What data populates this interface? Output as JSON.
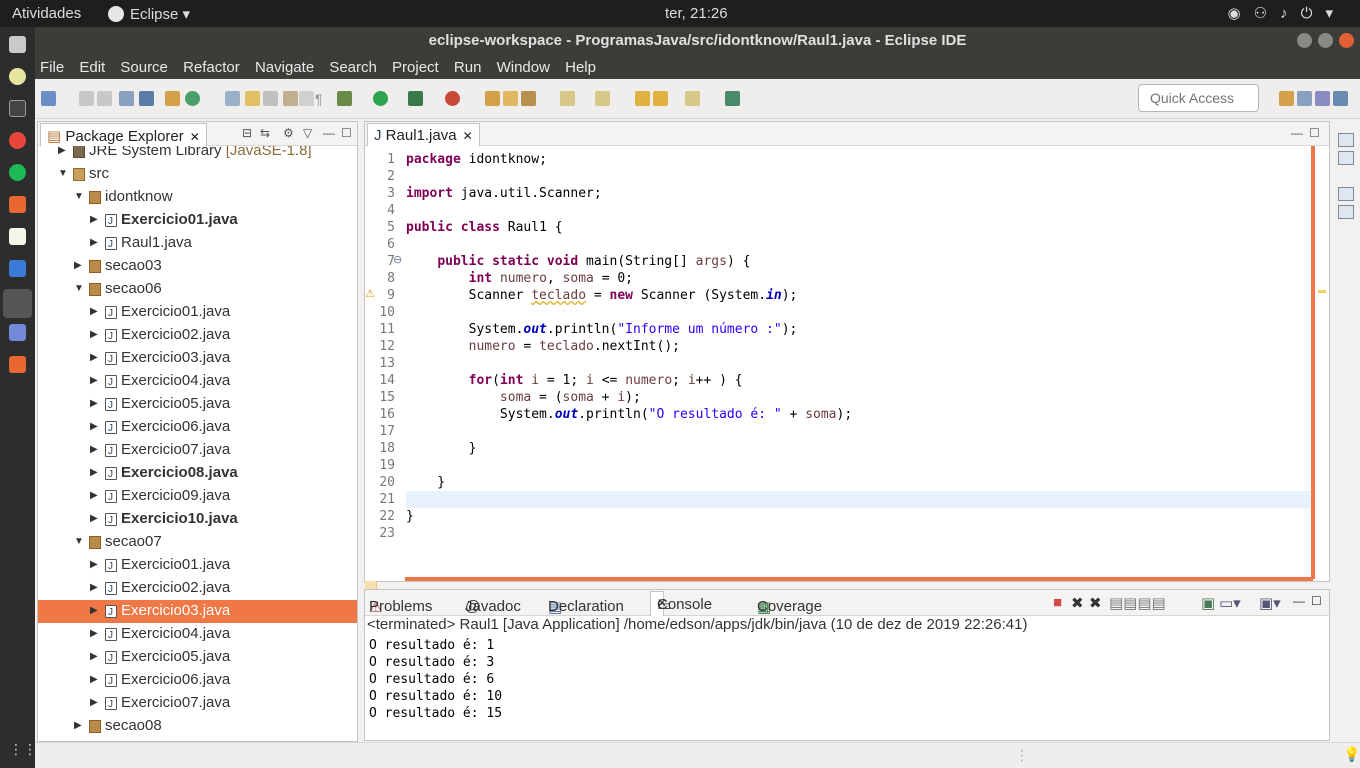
{
  "system_bar": {
    "activities": "Atividades",
    "app_name": "Eclipse",
    "clock": "ter, 21:26",
    "tray_icons": [
      "discord-icon",
      "network-icon",
      "volume-icon",
      "power-icon"
    ]
  },
  "window": {
    "title": "eclipse-workspace - ProgramasJava/src/idontknow/Raul1.java - Eclipse IDE"
  },
  "menu": [
    "File",
    "Edit",
    "Source",
    "Refactor",
    "Navigate",
    "Search",
    "Project",
    "Run",
    "Window",
    "Help"
  ],
  "quick_access": {
    "placeholder": "Quick Access"
  },
  "package_explorer": {
    "tab_label": "Package Explorer",
    "tree": [
      {
        "label": "JRE System Library",
        "suffix": "[JavaSE-1.8]",
        "icon": "library-icon",
        "indent": 1,
        "expanded": false,
        "bold": false
      },
      {
        "label": "src",
        "icon": "source-folder-icon",
        "indent": 1,
        "expanded": true,
        "bold": false
      },
      {
        "label": "idontknow",
        "icon": "package-icon",
        "indent": 2,
        "expanded": true,
        "bold": false
      },
      {
        "label": "Exercicio01.java",
        "icon": "java-file-icon",
        "indent": 3,
        "expanded": false,
        "bold": true
      },
      {
        "label": "Raul1.java",
        "icon": "java-file-icon",
        "indent": 3,
        "expanded": false,
        "bold": false
      },
      {
        "label": "secao03",
        "icon": "package-icon",
        "indent": 2,
        "expanded": false,
        "bold": false
      },
      {
        "label": "secao06",
        "icon": "package-icon",
        "indent": 2,
        "expanded": true,
        "bold": false
      },
      {
        "label": "Exercicio01.java",
        "icon": "java-file-icon",
        "indent": 3,
        "expanded": false,
        "bold": false
      },
      {
        "label": "Exercicio02.java",
        "icon": "java-file-icon",
        "indent": 3,
        "expanded": false,
        "bold": false
      },
      {
        "label": "Exercicio03.java",
        "icon": "java-file-icon",
        "indent": 3,
        "expanded": false,
        "bold": false
      },
      {
        "label": "Exercicio04.java",
        "icon": "java-file-icon",
        "indent": 3,
        "expanded": false,
        "bold": false
      },
      {
        "label": "Exercicio05.java",
        "icon": "java-file-icon",
        "indent": 3,
        "expanded": false,
        "bold": false
      },
      {
        "label": "Exercicio06.java",
        "icon": "java-file-icon",
        "indent": 3,
        "expanded": false,
        "bold": false
      },
      {
        "label": "Exercicio07.java",
        "icon": "java-file-icon",
        "indent": 3,
        "expanded": false,
        "bold": false
      },
      {
        "label": "Exercicio08.java",
        "icon": "java-file-icon",
        "indent": 3,
        "expanded": false,
        "bold": true
      },
      {
        "label": "Exercicio09.java",
        "icon": "java-file-icon",
        "indent": 3,
        "expanded": false,
        "bold": false
      },
      {
        "label": "Exercicio10.java",
        "icon": "java-file-icon",
        "indent": 3,
        "expanded": false,
        "bold": true
      },
      {
        "label": "secao07",
        "icon": "package-icon",
        "indent": 2,
        "expanded": true,
        "bold": false
      },
      {
        "label": "Exercicio01.java",
        "icon": "java-file-icon",
        "indent": 3,
        "expanded": false,
        "bold": false
      },
      {
        "label": "Exercicio02.java",
        "icon": "java-file-icon",
        "indent": 3,
        "expanded": false,
        "bold": false
      },
      {
        "label": "Exercicio03.java",
        "icon": "java-file-icon",
        "indent": 3,
        "expanded": false,
        "bold": false,
        "selected": true
      },
      {
        "label": "Exercicio04.java",
        "icon": "java-file-icon",
        "indent": 3,
        "expanded": false,
        "bold": false
      },
      {
        "label": "Exercicio05.java",
        "icon": "java-file-icon",
        "indent": 3,
        "expanded": false,
        "bold": false
      },
      {
        "label": "Exercicio06.java",
        "icon": "java-file-icon",
        "indent": 3,
        "expanded": false,
        "bold": false
      },
      {
        "label": "Exercicio07.java",
        "icon": "java-file-icon",
        "indent": 3,
        "expanded": false,
        "bold": false
      },
      {
        "label": "secao08",
        "icon": "package-icon",
        "indent": 2,
        "expanded": false,
        "bold": false
      }
    ]
  },
  "editor": {
    "tab_label": "Raul1.java",
    "current_line": 21,
    "lines": [
      [
        [
          "kw",
          "package"
        ],
        [
          "t",
          " idontknow;"
        ]
      ],
      [],
      [
        [
          "kw",
          "import"
        ],
        [
          "t",
          " java.util.Scanner;"
        ]
      ],
      [],
      [
        [
          "kw",
          "public"
        ],
        [
          "t",
          " "
        ],
        [
          "kw",
          "class"
        ],
        [
          "t",
          " Raul1 {"
        ]
      ],
      [],
      [
        [
          "t",
          "    "
        ],
        [
          "kw",
          "public"
        ],
        [
          "t",
          " "
        ],
        [
          "kw",
          "static"
        ],
        [
          "t",
          " "
        ],
        [
          "kw",
          "void"
        ],
        [
          "t",
          " main(String[] "
        ],
        [
          "var",
          "args"
        ],
        [
          "t",
          ") {"
        ]
      ],
      [
        [
          "t",
          "        "
        ],
        [
          "kw",
          "int"
        ],
        [
          "t",
          " "
        ],
        [
          "var",
          "numero"
        ],
        [
          "t",
          ", "
        ],
        [
          "var",
          "soma"
        ],
        [
          "t",
          " = 0;"
        ]
      ],
      [
        [
          "t",
          "        Scanner "
        ],
        [
          "var",
          "teclado"
        ],
        [
          "t",
          " = "
        ],
        [
          "kw",
          "new"
        ],
        [
          "t",
          " Scanner (System."
        ],
        [
          "fld",
          "in"
        ],
        [
          "t",
          ");"
        ]
      ],
      [],
      [
        [
          "t",
          "        System."
        ],
        [
          "fld",
          "out"
        ],
        [
          "t",
          ".println("
        ],
        [
          "str",
          "\"Informe um número :\""
        ],
        [
          "t",
          ");"
        ]
      ],
      [
        [
          "t",
          "        "
        ],
        [
          "var",
          "numero"
        ],
        [
          "t",
          " = "
        ],
        [
          "var",
          "teclado"
        ],
        [
          "t",
          ".nextInt();"
        ]
      ],
      [],
      [
        [
          "t",
          "        "
        ],
        [
          "kw",
          "for"
        ],
        [
          "t",
          "("
        ],
        [
          "kw",
          "int"
        ],
        [
          "t",
          " "
        ],
        [
          "var",
          "i"
        ],
        [
          "t",
          " = 1; "
        ],
        [
          "var",
          "i"
        ],
        [
          "t",
          " <= "
        ],
        [
          "var",
          "numero"
        ],
        [
          "t",
          "; "
        ],
        [
          "var",
          "i"
        ],
        [
          "t",
          "++ ) {"
        ]
      ],
      [
        [
          "t",
          "            "
        ],
        [
          "var",
          "soma"
        ],
        [
          "t",
          " = ("
        ],
        [
          "var",
          "soma"
        ],
        [
          "t",
          " + "
        ],
        [
          "var",
          "i"
        ],
        [
          "t",
          ");"
        ]
      ],
      [
        [
          "t",
          "            System."
        ],
        [
          "fld",
          "out"
        ],
        [
          "t",
          ".println("
        ],
        [
          "str",
          "\"O resultado é: \""
        ],
        [
          "t",
          " + "
        ],
        [
          "var",
          "soma"
        ],
        [
          "t",
          ");"
        ]
      ],
      [],
      [
        [
          "t",
          "        }"
        ]
      ],
      [],
      [
        [
          "t",
          "    }"
        ]
      ],
      [],
      [
        [
          "t",
          "}"
        ]
      ],
      []
    ]
  },
  "bottom_panel": {
    "tabs": [
      "Problems",
      "Javadoc",
      "Declaration",
      "Console",
      "Coverage"
    ],
    "active_tab": "Console",
    "status_line": "<terminated> Raul1 [Java Application] /home/edson/apps/jdk/bin/java (10 de dez de 2019 22:26:41)",
    "output": [
      "O resultado é: 1",
      "O resultado é: 3",
      "O resultado é: 6",
      "O resultado é: 10",
      "O resultado é: 15"
    ]
  },
  "colors": {
    "selection": "#f07746",
    "keyword": "#7f0055",
    "string": "#2a00ff",
    "field": "#0000c0",
    "variable": "#6a3e3e"
  }
}
